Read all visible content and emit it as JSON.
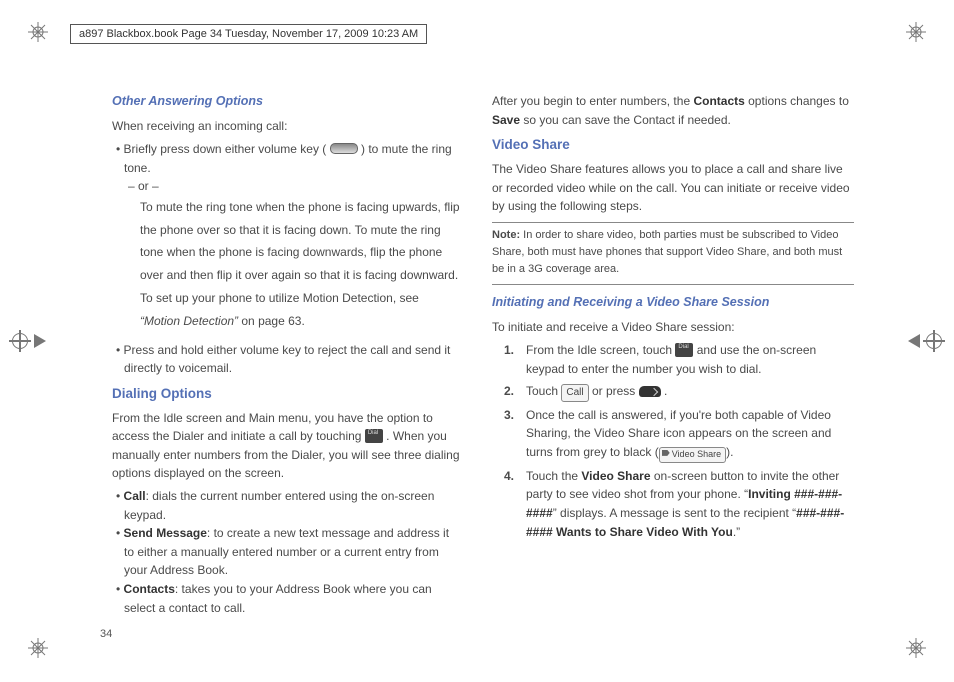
{
  "doc_header": "a897 Blackbox.book  Page 34  Tuesday, November 17, 2009  10:23 AM",
  "page_number": "34",
  "left": {
    "h_other_answering": "Other Answering Options",
    "p_receiving": "When receiving an incoming call:",
    "b_volume_mute_pre": "Briefly press down either volume key (",
    "b_volume_mute_post": ") to mute the ring tone.",
    "or_dash": "– or –",
    "p_flip_para": "To mute the ring tone when the phone is facing upwards, flip the phone over so that it is facing down. To mute the ring tone when the phone is facing downwards, flip the phone over and then flip it over again so that it is facing downward. To set up your phone to utilize Motion Detection, see ",
    "p_flip_link": "“Motion Detection”",
    "p_flip_tail": " on page 63.",
    "b_reject": "Press and hold either volume key to reject the call and send it directly to voicemail.",
    "h_dialing": "Dialing Options",
    "p_dialing_intro_pre": "From the Idle screen and Main menu, you have the option to access the Dialer and initiate a call by touching ",
    "p_dialing_intro_post": ". When you manually enter numbers from the Dialer, you will see three dialing options displayed on the screen.",
    "b_call_label": "Call",
    "b_call_text": ": dials the current number entered using the on-screen keypad.",
    "b_send_label": "Send Message",
    "b_send_text": ": to create a new text message and address it to either a manually entered number or a current entry from your Address Book.",
    "b_contacts_label": "Contacts",
    "b_contacts_text": ": takes you to your Address Book where you can select a contact to call."
  },
  "right": {
    "p_after_begin_a": "After you begin to enter numbers, the ",
    "p_after_begin_b": "Contacts",
    "p_after_begin_c": " options changes to ",
    "p_after_begin_d": "Save",
    "p_after_begin_e": " so you can save the Contact if needed.",
    "h_video_share": "Video Share",
    "p_vs_intro": "The Video Share features allows you to place a call and share live or recorded video while on the call. You can initiate or receive video by using the following steps.",
    "note_label": "Note:",
    "note_body": " In order to share video, both parties must be subscribed to Video Share, both must have phones that support Video Share, and both must be in a 3G coverage area.",
    "h_init_vs": "Initiating and Receiving a Video Share Session",
    "p_init_lead": "To initiate and receive a Video Share session:",
    "s1_a": "From the Idle screen, touch ",
    "s1_b": " and use the on-screen keypad to enter the number you wish to dial.",
    "s2_a": "Touch ",
    "s2_b": " or press ",
    "s2_c": ".",
    "s3_a": "Once the call is answered, if you're both capable of Video Sharing, the Video Share icon appears on the screen and turns from grey to black (",
    "s3_b": ").",
    "s4_a": "Touch the ",
    "s4_b": "Video Share",
    "s4_c": " on-screen button to invite the other party to see video shot from your phone. “",
    "s4_d": "Inviting ###-###-####",
    "s4_e": "” displays. A message is sent to the recipient “",
    "s4_f": "###-###-#### Wants to Share Video With You",
    "s4_g": ".”",
    "call_box_label": "Call",
    "vshare_box_label": "Video Share"
  }
}
